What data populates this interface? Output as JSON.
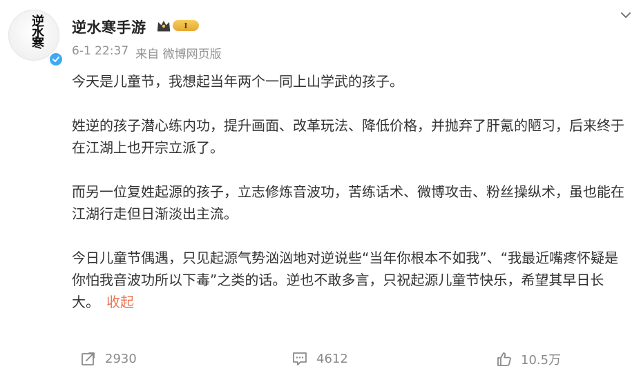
{
  "post": {
    "username": "逆水寒手游",
    "level": "I",
    "time": "6-1 22:37",
    "source": "来自 微博网页版",
    "avatar_text": "逆水寒",
    "paragraphs": [
      "今天是儿童节，我想起当年两个一同上山学武的孩子。",
      "姓逆的孩子潜心练内功，提升画面、改革玩法、降低价格，并抛弃了肝氪的陋习，后来终于在江湖上也开宗立派了。",
      "而另一位复姓起源的孩子，立志修炼音波功，苦练话术、微博攻击、粉丝操纵术，虽也能在江湖行走但日渐淡出主流。",
      "今日儿童节偶遇，只见起源气势汹汹地对逆说些“当年你根本不如我”、“我最近嘴疼怀疑是你怕我音波功所以下毒”之类的话。逆也不敢多言，只祝起源儿童节快乐，希望其早日长大。"
    ],
    "collapse_label": "收起"
  },
  "actions": {
    "repost": "2930",
    "comment": "4612",
    "like": "10.5万"
  },
  "colors": {
    "accent": "#eb7350",
    "verified": "#3fa9f5",
    "muted": "#939393"
  }
}
